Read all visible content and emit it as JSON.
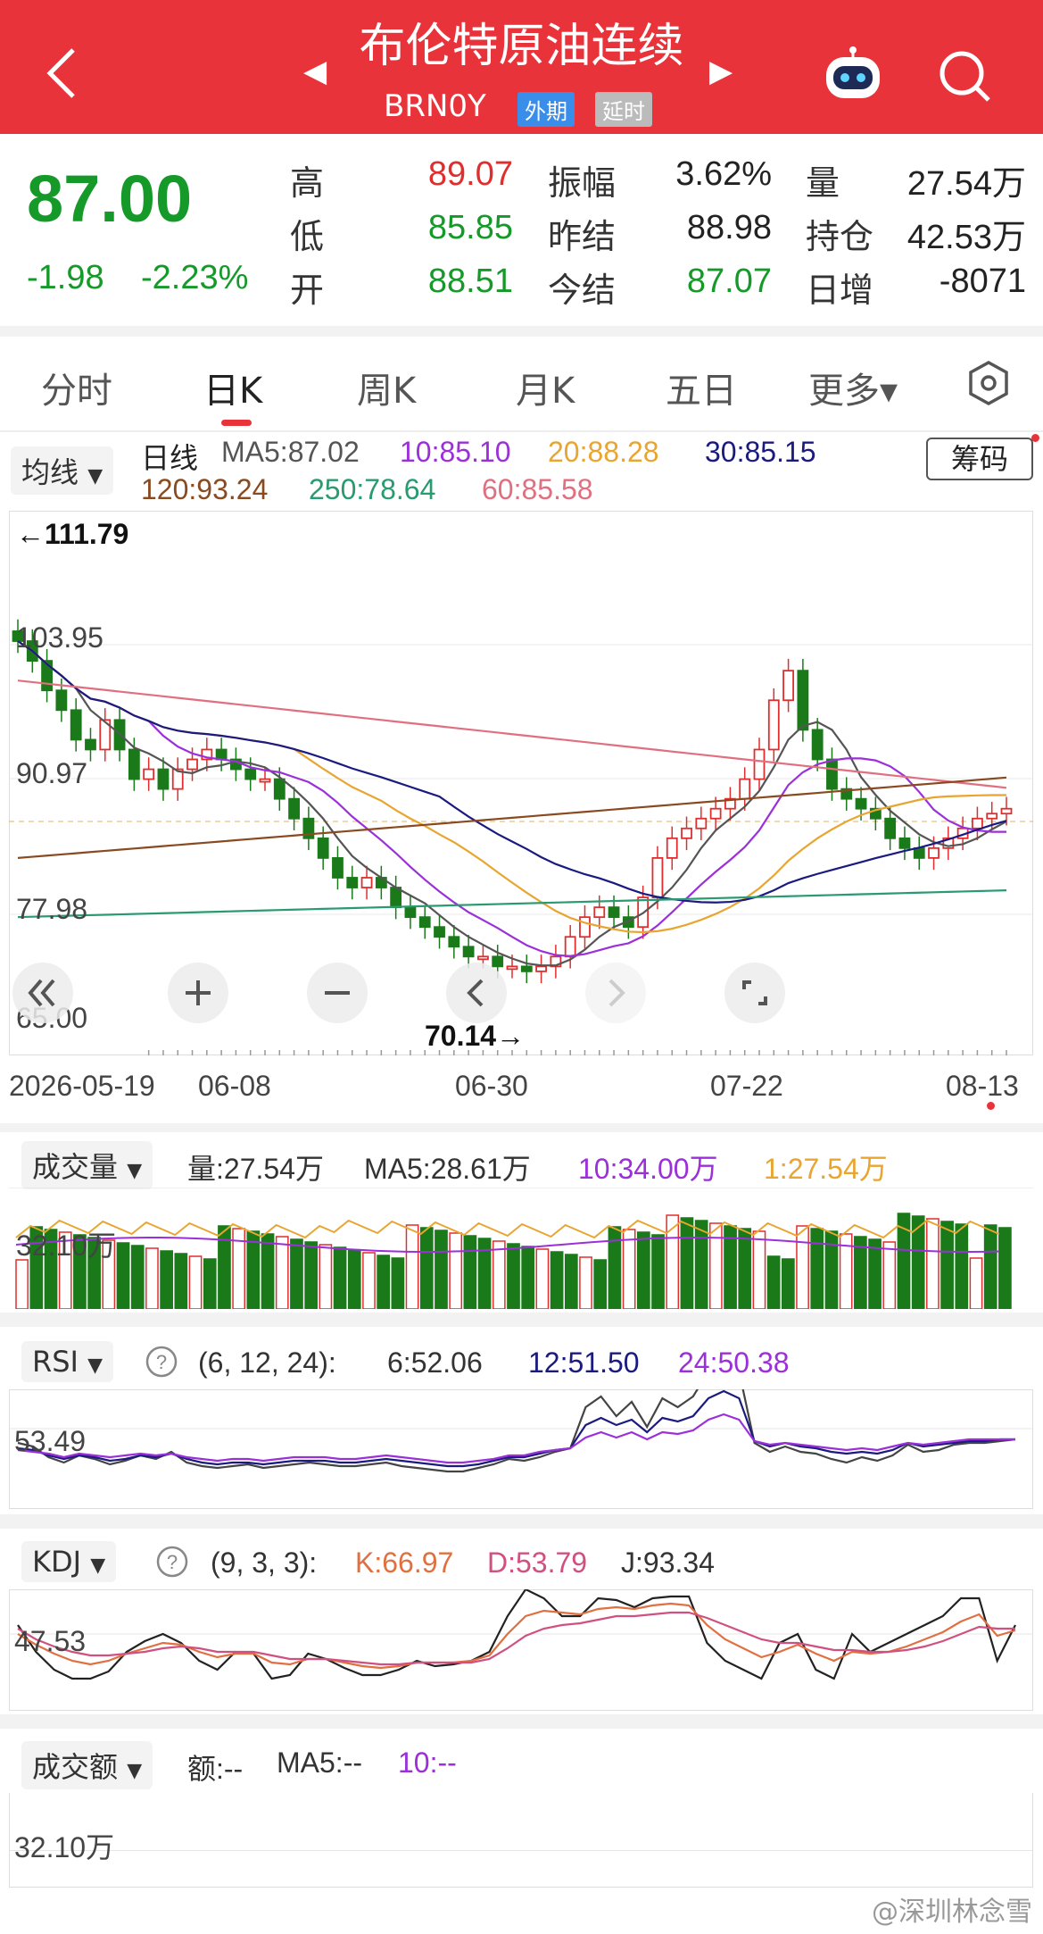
{
  "header": {
    "title": "布伦特原油连续",
    "code": "BRN0Y",
    "tag_foreign": "外期",
    "tag_delay": "延时"
  },
  "quote": {
    "price": "87.00",
    "change": "-1.98",
    "change_pct": "-2.23%",
    "labels": {
      "high": "高",
      "low": "低",
      "open": "开",
      "amp": "振幅",
      "prev": "昨结",
      "settle": "今结",
      "vol": "量",
      "oi": "持仓",
      "daily": "日增"
    },
    "values": {
      "high": "89.07",
      "low": "85.85",
      "open": "88.51",
      "amp": "3.62%",
      "prev": "88.98",
      "settle": "87.07",
      "vol": "27.54万",
      "oi": "42.53万",
      "daily": "-8071"
    }
  },
  "tabs": [
    "分时",
    "日K",
    "周K",
    "月K",
    "五日",
    "更多▾"
  ],
  "kline": {
    "ma_pill": "均线",
    "period": "日线",
    "ma5": "MA5:87.02",
    "ma10": "10:85.10",
    "ma20": "20:88.28",
    "ma30": "30:85.15",
    "ma120": "120:93.24",
    "ma250": "250:78.64",
    "ma60": "60:85.58",
    "chip_button": "筹码",
    "y_labels": [
      "111.79",
      "103.95",
      "90.97",
      "77.98",
      "65.00"
    ],
    "max_note": "←111.79",
    "min_note": "70.14→",
    "dates": [
      "2026-05-19",
      "06-08",
      "06-30",
      "07-22",
      "08-13"
    ]
  },
  "volume": {
    "pill": "成交量",
    "vol": "量:27.54万",
    "ma5": "MA5:28.61万",
    "ma10": "10:34.00万",
    "ma1": "1:27.54万",
    "y_label": "32.10万"
  },
  "rsi": {
    "pill": "RSI",
    "params": "(6, 12, 24):",
    "r6": "6:52.06",
    "r12": "12:51.50",
    "r24": "24:50.38",
    "y_label": "53.49"
  },
  "kdj": {
    "pill": "KDJ",
    "params": "(9, 3, 3):",
    "k": "K:66.97",
    "d": "D:53.79",
    "j": "J:93.34",
    "y_label": "47.53"
  },
  "amount": {
    "pill": "成交额",
    "amt": "额:--",
    "ma5": "MA5:--",
    "ma10": "10:--",
    "y_label": "32.10万"
  },
  "colors": {
    "up": "#e02e2e",
    "down": "#1a7a1a",
    "ma5": "#555555",
    "ma10": "#9b30d9",
    "ma20": "#e8a530",
    "ma30": "#1a1a80",
    "ma60": "#e07080",
    "ma120": "#8a4a20",
    "ma250": "#2a9a70"
  },
  "watermark": "@深圳林念雪"
}
